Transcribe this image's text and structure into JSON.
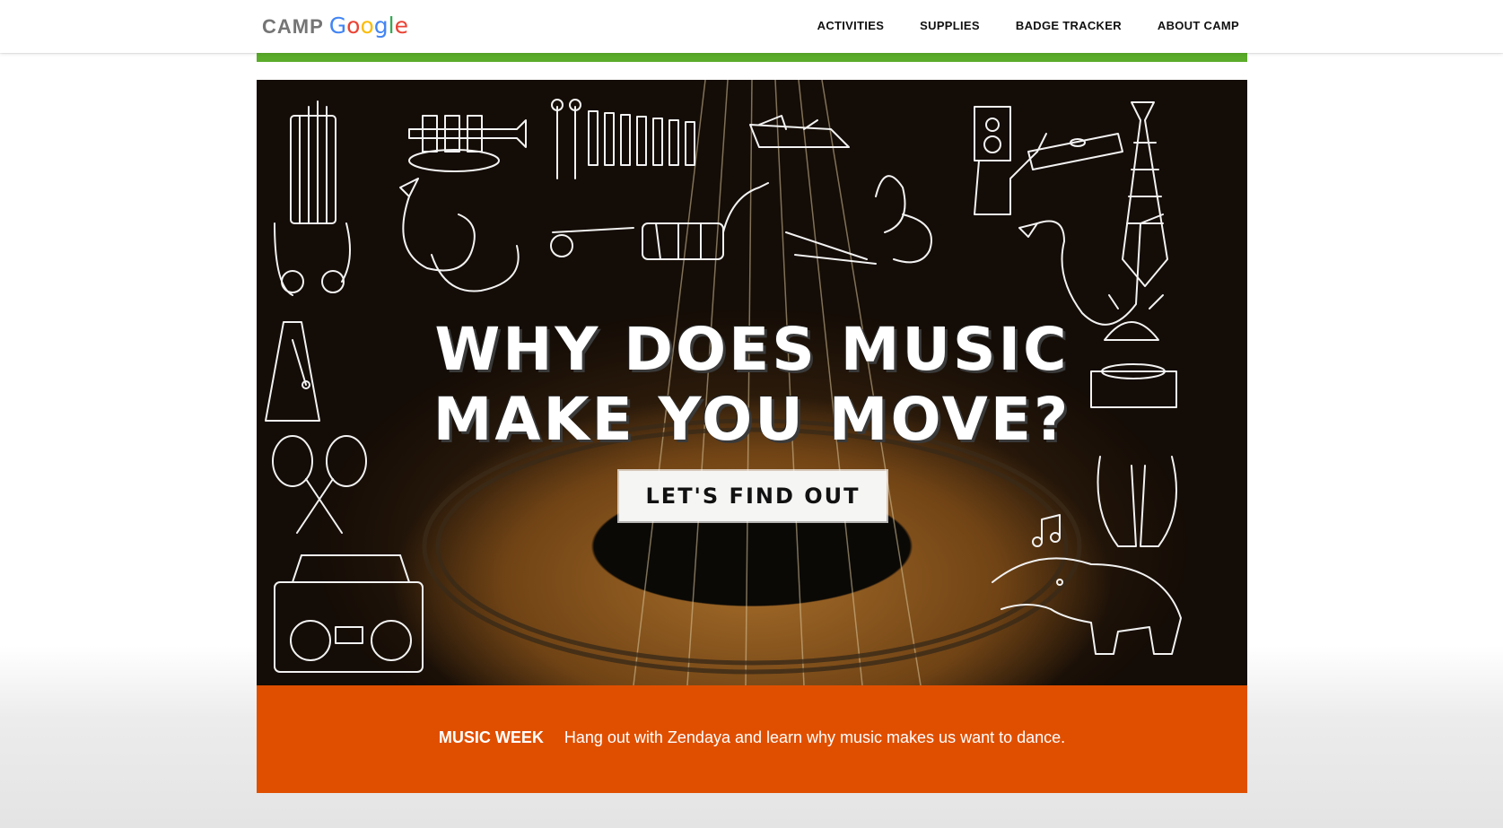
{
  "header": {
    "logo_camp": "CAMP",
    "logo_google_letters": [
      "G",
      "o",
      "o",
      "g",
      "l",
      "e"
    ],
    "nav": [
      "ACTIVITIES",
      "SUPPLIES",
      "BADGE TRACKER",
      "ABOUT CAMP"
    ]
  },
  "hero": {
    "title_line1": "WHY DOES MUSIC",
    "title_line2": "MAKE YOU MOVE?",
    "cta_label": "LET'S FIND OUT"
  },
  "band": {
    "label": "MUSIC WEEK",
    "text": "Hang out with Zendaya and learn why music makes us want to dance."
  },
  "colors": {
    "accent_green": "#5aac2a",
    "band_orange": "#e04f00"
  }
}
